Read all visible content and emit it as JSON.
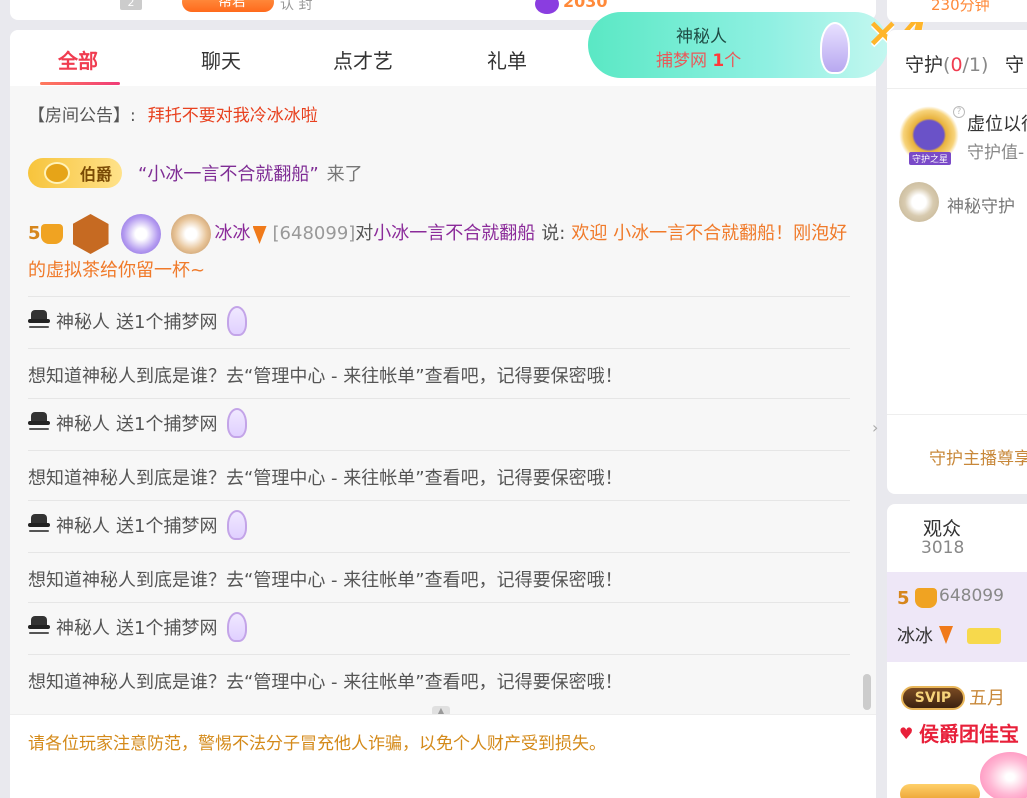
{
  "top_strip": {
    "count_badge": "2",
    "role_badge": "帮君",
    "follow_text": "认 封",
    "coin_value": "2030"
  },
  "tabs": [
    {
      "label": "全部",
      "active": true
    },
    {
      "label": "聊天",
      "active": false
    },
    {
      "label": "点才艺",
      "active": false
    },
    {
      "label": "礼单",
      "active": false
    }
  ],
  "banner": {
    "line1": "神秘人",
    "gift": "捕梦网",
    "count": "1",
    "unit": "个",
    "multiplier": "×4"
  },
  "notice": {
    "label": "【房间公告】:",
    "text": "拜托不要对我冷冰冰啦"
  },
  "entry": {
    "rank": "伯爵",
    "name": "“小冰一言不合就翻船”",
    "suffix": "来了"
  },
  "welcome": {
    "level": "5",
    "name": "冰冰",
    "id": "[648099]",
    "to": "对",
    "target": "小冰一言不合就翻船",
    "say": "说:",
    "text": "欢迎 小冰一言不合就翻船！刚泡好的虚拟茶给你留一杯~"
  },
  "gift_messages": [
    {
      "sender": "神秘人",
      "action": "送1个捕梦网",
      "tip": "想知道神秘人到底是谁？去“管理中心 - 来往帐单”查看吧，记得要保密哦！"
    },
    {
      "sender": "神秘人",
      "action": "送1个捕梦网",
      "tip": "想知道神秘人到底是谁？去“管理中心 - 来往帐单”查看吧，记得要保密哦！"
    },
    {
      "sender": "神秘人",
      "action": "送1个捕梦网",
      "tip": "想知道神秘人到底是谁？去“管理中心 - 来往帐单”查看吧，记得要保密哦！"
    },
    {
      "sender": "神秘人",
      "action": "送1个捕梦网",
      "tip": "想知道神秘人到底是谁？去“管理中心 - 来往帐单”查看吧，记得要保密哦！"
    }
  ],
  "warning": "请各位玩家注意防范，警惕不法分子冒充他人诈骗，以免个人财产受到损失。",
  "right_top": {
    "text": "230分钟"
  },
  "guard": {
    "tab_label": "守护",
    "current": "0",
    "total": "/1",
    "tab2": "守",
    "star_label": "守护之星",
    "vseat": "虚位以待",
    "value": "守护值-",
    "mystery": "神秘守护",
    "honor": "守护主播尊享"
  },
  "audience": {
    "label": "观众",
    "count": "3018",
    "user1": {
      "level": "5",
      "id": "648099",
      "name": "冰冰"
    },
    "user2": {
      "badge": "SVIP",
      "month": "五月",
      "title": "侯爵团佳宝"
    }
  },
  "colors": {
    "accent": "#f03c50",
    "gift_orange": "#f07a2a",
    "name_purple": "#8b2b9a",
    "warning_gold": "#d48a1a"
  }
}
